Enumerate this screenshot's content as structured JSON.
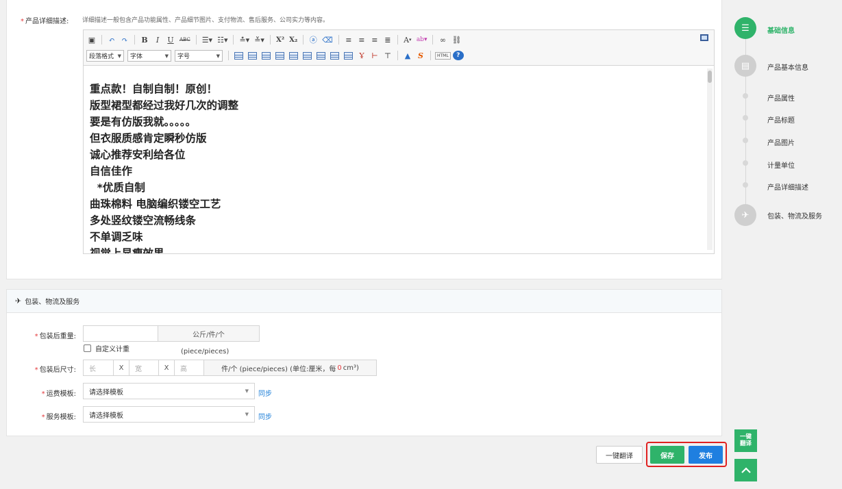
{
  "detail": {
    "label": "产品详细描述:",
    "hint": "详细描述一般包含产品功能属性、产品细节图片、支付物流、售后服务、公司实力等内容。"
  },
  "editor": {
    "selects": {
      "paragraph": "段落格式",
      "font": "字体",
      "size": "字号"
    },
    "text_buttons": {
      "bold": "B",
      "italic": "I",
      "underline": "U",
      "strike": "ABC",
      "superscript": "X²",
      "subscript": "X₂",
      "fontcolor": "A",
      "html": "HTML",
      "help": "?"
    },
    "lines": [
      "重点款！自制自制！原创！",
      "版型裙型都经过我好几次的调整",
      "要是有仿版我就。。。。。",
      "但衣服质感肯定瞬秒仿版",
      "诚心推荐安利给各位",
      "自信佳作",
      "  *优质自制",
      "曲珠棉料 电脑编织镂空工艺",
      "多处竖纹镂空流畅线条",
      "不单调乏味",
      "视觉上显瘦效果"
    ]
  },
  "packaging": {
    "section_title": "包装、物流及服务",
    "weight_label": "包装后重量:",
    "weight_value": "",
    "weight_unit": "公斤/件/个",
    "custom_weight": "自定义计重",
    "piece_unit": "(piece/pieces)",
    "size_label": "包装后尺寸:",
    "length_ph": "长",
    "width_ph": "宽",
    "height_ph": "高",
    "x": "X",
    "size_unit_prefix": "件/个 (piece/pieces) (单位:厘米，每",
    "size_unit_value": "0",
    "size_unit_suffix": "cm³)",
    "freight_label": "运费模板:",
    "freight_value": "请选择模板",
    "service_label": "服务模板:",
    "service_value": "请选择模板",
    "sync": "同步"
  },
  "actions": {
    "translate": "一键翻译",
    "save": "保存",
    "publish": "发布"
  },
  "nav": {
    "items": [
      {
        "label": "基础信息",
        "kind": "big",
        "active": true
      },
      {
        "label": "产品基本信息",
        "kind": "big"
      },
      {
        "label": "产品属性",
        "kind": "dot"
      },
      {
        "label": "产品标题",
        "kind": "dot"
      },
      {
        "label": "产品图片",
        "kind": "dot"
      },
      {
        "label": "计量单位",
        "kind": "dot"
      },
      {
        "label": "产品详细描述",
        "kind": "dot"
      },
      {
        "label": "包装、物流及服务",
        "kind": "big"
      }
    ]
  },
  "side": {
    "translate_line1": "一键",
    "translate_line2": "翻译"
  },
  "colors": {
    "green": "#2fb36a",
    "blue": "#1f7fe0",
    "required": "#e4393c",
    "highlight": "#e02020"
  }
}
